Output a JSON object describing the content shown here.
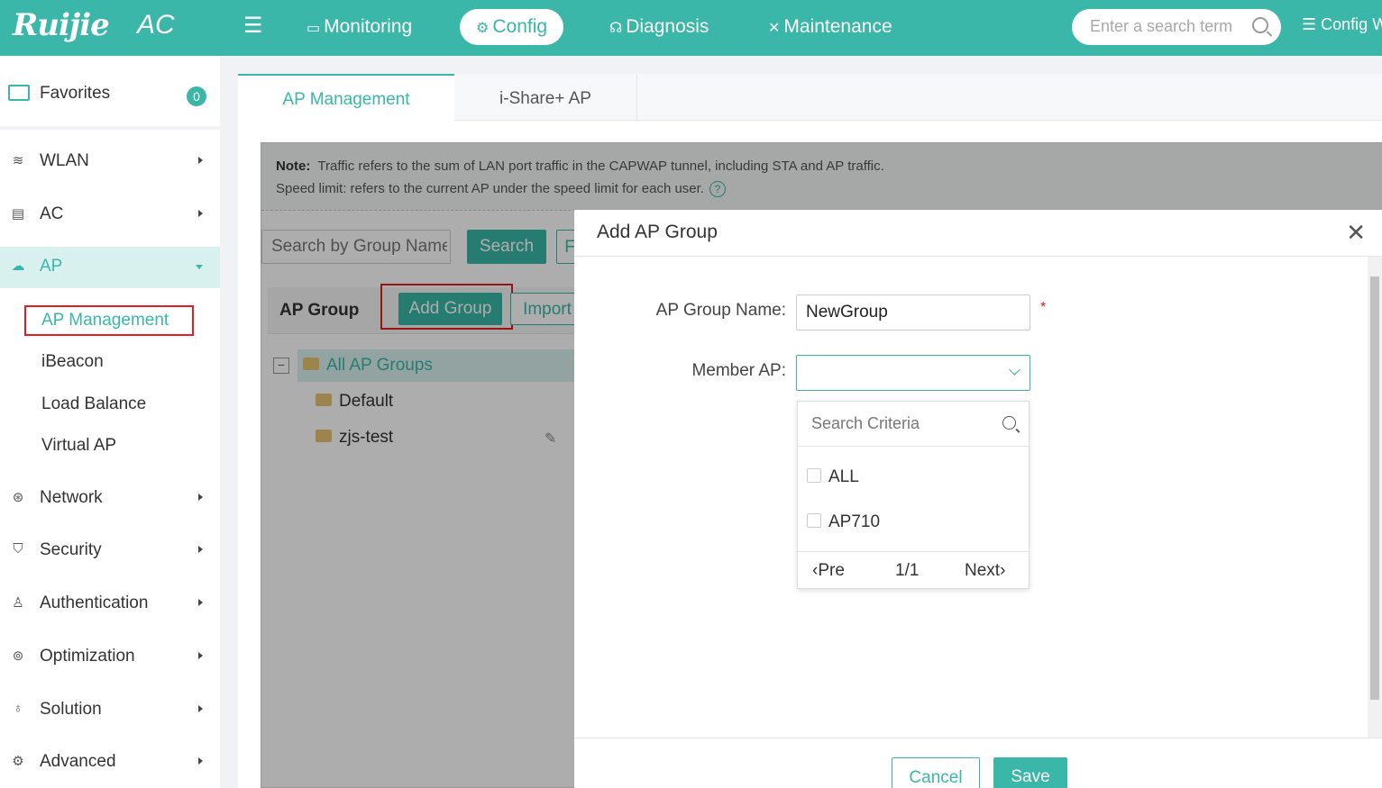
{
  "header": {
    "brand": "Ruijie",
    "product": "AC",
    "nav": [
      {
        "label": "Monitoring",
        "icon": "monitor-icon"
      },
      {
        "label": "Config",
        "icon": "gear-icon"
      },
      {
        "label": "Diagnosis",
        "icon": "stethoscope-icon"
      },
      {
        "label": "Maintenance",
        "icon": "tools-icon"
      }
    ],
    "active_nav": "Config",
    "search_placeholder": "Enter a search term",
    "config_wizard": "Config W",
    "accent_color": "#3ab7a9"
  },
  "sidebar": {
    "favorites_label": "Favorites",
    "favorites_count": "0",
    "items": [
      {
        "label": "WLAN",
        "icon": "wifi-icon"
      },
      {
        "label": "AC",
        "icon": "ac-icon"
      },
      {
        "label": "AP",
        "icon": "ap-icon"
      },
      {
        "label": "Network",
        "icon": "globe-icon"
      },
      {
        "label": "Security",
        "icon": "shield-icon"
      },
      {
        "label": "Authentication",
        "icon": "user-icon"
      },
      {
        "label": "Optimization",
        "icon": "optimize-icon"
      },
      {
        "label": "Solution",
        "icon": "bulb-icon"
      },
      {
        "label": "Advanced",
        "icon": "settings-icon"
      }
    ],
    "ap_subitems": [
      "AP Management",
      "iBeacon",
      "Load Balance",
      "Virtual AP"
    ]
  },
  "tabs": [
    "AP Management",
    "i-Share+ AP"
  ],
  "note": {
    "label": "Note:",
    "line1": "Traffic refers to the sum of LAN port traffic in the CAPWAP tunnel, including STA and AP traffic.",
    "line2": "Speed limit: refers to the current AP under the speed limit for each user."
  },
  "toolbar": {
    "search_placeholder": "Search by Group Name",
    "search_button": "Search",
    "partial_button": "F"
  },
  "ap_group": {
    "title": "AP Group",
    "add_button": "Add Group",
    "import_button": "Import",
    "tree": [
      "All AP Groups",
      "Default",
      "zjs-test"
    ]
  },
  "modal": {
    "title": "Add AP Group",
    "group_name_label": "AP Group Name:",
    "group_name_value": "NewGroup",
    "required_mark": "*",
    "member_label": "Member AP:",
    "dropdown": {
      "search_placeholder": "Search Criteria",
      "options": [
        "ALL",
        "AP710"
      ],
      "prev": "Pre",
      "page": "1/1",
      "next": "Next"
    },
    "cancel": "Cancel",
    "save": "Save"
  }
}
